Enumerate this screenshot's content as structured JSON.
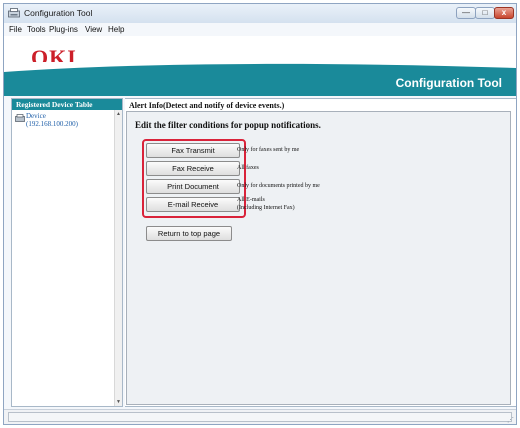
{
  "window": {
    "title": "Configuration Tool",
    "icon": "app-icon"
  },
  "window_controls": {
    "minimize": "—",
    "maximize": "□",
    "close": "x"
  },
  "menu": [
    "File",
    "Tools",
    "Plug-ins",
    "View",
    "Help"
  ],
  "banner": {
    "logo": "OKI",
    "title": "Configuration Tool",
    "accent_color": "#1a8a9a",
    "logo_color": "#cc1f29"
  },
  "sidebar": {
    "heading": "Registered Device Table",
    "devices": [
      {
        "name": "Device",
        "ip": "(192.168.100.200)",
        "icon": "printer-icon"
      }
    ]
  },
  "content": {
    "section_title": "Alert Info(Detect and notify of device events.)",
    "heading": "Edit the filter conditions for popup notifications.",
    "filters": [
      {
        "button": "Fax Transmit",
        "description": [
          "Only for faxes sent by me"
        ]
      },
      {
        "button": "Fax Receive",
        "description": [
          "All faxes"
        ]
      },
      {
        "button": "Print Document",
        "description": [
          "Only for documents printed by me"
        ]
      },
      {
        "button": "E-mail Receive",
        "description": [
          "All E-mails",
          "(Including Internet Fax)"
        ]
      }
    ],
    "highlight_color": "#d9233a",
    "return_button": "Return to top page"
  }
}
